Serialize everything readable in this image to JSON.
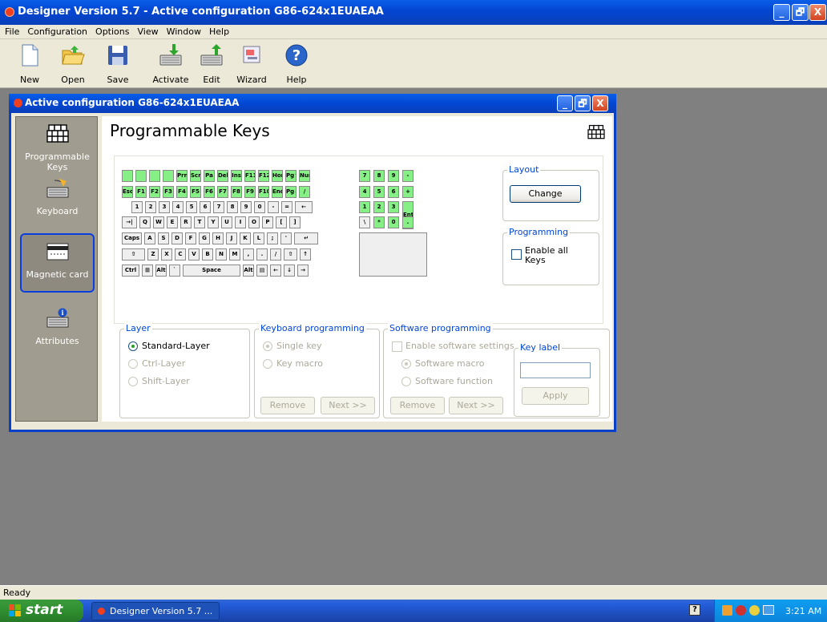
{
  "app": {
    "title": "Designer Version 5.7 - Active configuration G86-624x1EUAEAA",
    "minimize": "_",
    "maximize": "🗗",
    "close": "X"
  },
  "menu": [
    "File",
    "Configuration",
    "Options",
    "View",
    "Window",
    "Help"
  ],
  "toolbar": [
    {
      "label": "New",
      "icon": "new-document-icon"
    },
    {
      "label": "Open",
      "icon": "open-folder-icon"
    },
    {
      "label": "Save",
      "icon": "save-disk-icon"
    },
    {
      "label": "Activate",
      "icon": "activate-keyboard-icon"
    },
    {
      "label": "Edit",
      "icon": "edit-keyboard-icon"
    },
    {
      "label": "Wizard",
      "icon": "wizard-icon"
    },
    {
      "label": "Help",
      "icon": "help-icon"
    }
  ],
  "child": {
    "title": "Active configuration G86-624x1EUAEAA"
  },
  "sidebar": [
    {
      "label": "Programmable Keys",
      "icon": "programmable-keys-icon"
    },
    {
      "label": "Keyboard",
      "icon": "keyboard-icon"
    },
    {
      "label": "Magnetic card",
      "icon": "magnetic-card-icon",
      "selected": true
    },
    {
      "label": "Attributes",
      "icon": "attributes-icon"
    }
  ],
  "page": {
    "title": "Programmable Keys",
    "icon": "programmable-keys-icon"
  },
  "layout": {
    "title": "Layout",
    "button": "Change"
  },
  "programming": {
    "title": "Programming",
    "checkbox": "Enable all Keys"
  },
  "layer": {
    "title": "Layer",
    "options": [
      "Standard-Layer",
      "Ctrl-Layer",
      "Shift-Layer"
    ],
    "selected": "Standard-Layer"
  },
  "kbprog": {
    "title": "Keyboard programming",
    "options": [
      "Single key",
      "Key macro"
    ],
    "remove": "Remove",
    "next": "Next >>"
  },
  "swprog": {
    "title": "Software programming",
    "checkbox": "Enable software settings",
    "options": [
      "Software macro",
      "Software function"
    ],
    "remove": "Remove",
    "next": "Next >>"
  },
  "keylabel": {
    "title": "Key label",
    "value": "",
    "apply": "Apply"
  },
  "keyboard": {
    "rows": [
      [
        "",
        "",
        "",
        "",
        "Prn",
        "Scr",
        "Pa",
        "Del",
        "Ins",
        "F11",
        "F12",
        "Hom",
        "Pg↑",
        "Num",
        "7",
        "8",
        "9",
        "-"
      ],
      [
        "Esc",
        "F1",
        "F2",
        "F3",
        "F4",
        "F5",
        "F6",
        "F7",
        "F8",
        "F9",
        "F10",
        "End",
        "Pg↓",
        "/",
        "4",
        "5",
        "6",
        "+"
      ],
      [
        "1",
        "2",
        "3",
        "4",
        "5",
        "6",
        "7",
        "8",
        "9",
        "0",
        "-",
        "=",
        "←",
        "1",
        "2",
        "3",
        "Ent"
      ],
      [
        "→|",
        "Q",
        "W",
        "E",
        "R",
        "T",
        "Y",
        "U",
        "I",
        "O",
        "P",
        "[",
        "]",
        "\\",
        "*",
        "0",
        "."
      ],
      [
        "Caps",
        "A",
        "S",
        "D",
        "F",
        "G",
        "H",
        "J",
        "K",
        "L",
        ";",
        "'",
        "↵"
      ],
      [
        "⇧",
        "Z",
        "X",
        "C",
        "V",
        "B",
        "N",
        "M",
        ",",
        ".",
        "/",
        "⇧",
        "↑"
      ],
      [
        "Ctrl",
        "⊞",
        "Alt",
        "`",
        "Space",
        "Alt",
        "▤",
        "←",
        "↓",
        "→"
      ]
    ]
  },
  "status": {
    "text": "Ready"
  },
  "taskbar": {
    "start": "start",
    "task": "Designer Version 5.7 ...",
    "clock": "3:21 AM"
  },
  "colors": {
    "title_blue": "#0347d4",
    "key_green": "#86f086",
    "desktop": "#808080",
    "select_blue": "#0a3ee0"
  }
}
